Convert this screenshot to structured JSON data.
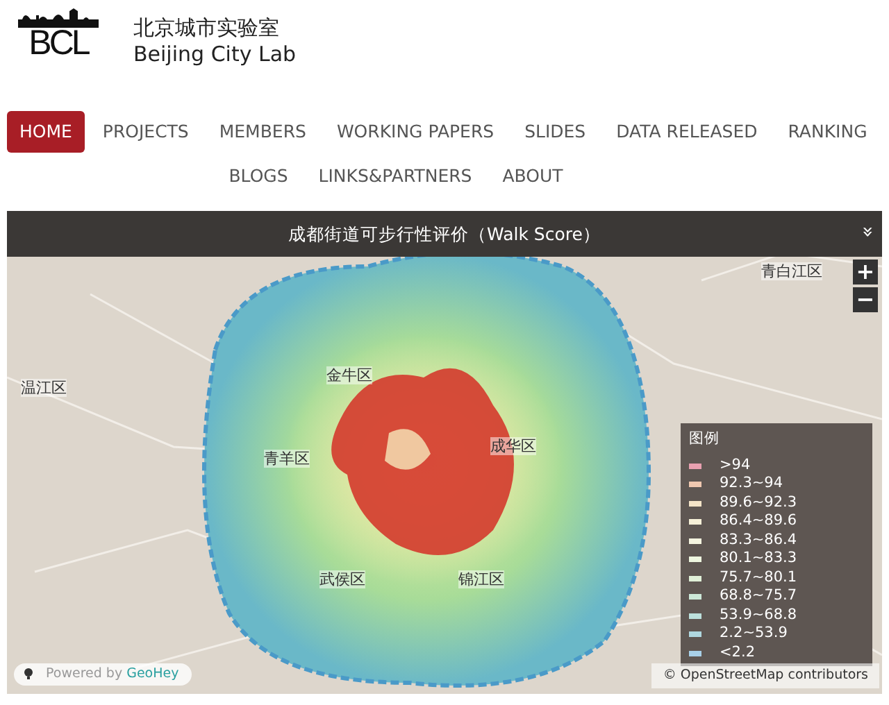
{
  "header": {
    "logo_text": "BCL",
    "title_cn": "北京城市实验室",
    "title_en": "Beijing City Lab"
  },
  "nav": [
    {
      "label": "HOME",
      "selected": true
    },
    {
      "label": "PROJECTS",
      "selected": false
    },
    {
      "label": "MEMBERS",
      "selected": false
    },
    {
      "label": "WORKING PAPERS",
      "selected": false
    },
    {
      "label": "SLIDES",
      "selected": false
    },
    {
      "label": "DATA RELEASED",
      "selected": false
    },
    {
      "label": "RANKING",
      "selected": false
    },
    {
      "label": "BLOGS",
      "selected": false
    },
    {
      "label": "LINKS&PARTNERS",
      "selected": false
    },
    {
      "label": "ABOUT",
      "selected": false
    }
  ],
  "map": {
    "title": "成都街道可步行性评价（Walk Score）",
    "collapse_icon": "»",
    "zoom_in": "+",
    "zoom_out": "−",
    "labels": [
      {
        "text": "青白江区",
        "kind": "district"
      },
      {
        "text": "温江区",
        "kind": "district"
      },
      {
        "text": "金牛区",
        "kind": "district"
      },
      {
        "text": "青羊区",
        "kind": "district"
      },
      {
        "text": "成华区",
        "kind": "district"
      },
      {
        "text": "武侯区",
        "kind": "district"
      },
      {
        "text": "锦江区",
        "kind": "district"
      }
    ],
    "legend": {
      "title": "图例",
      "items": [
        {
          "label": ">94",
          "color": "#e8a0b0"
        },
        {
          "label": "92.3~94",
          "color": "#f0c8b0"
        },
        {
          "label": "89.6~92.3",
          "color": "#f4e4c8"
        },
        {
          "label": "86.4~89.6",
          "color": "#f6f0d8"
        },
        {
          "label": "83.3~86.4",
          "color": "#f4f4e0"
        },
        {
          "label": "80.1~83.3",
          "color": "#eef6e0"
        },
        {
          "label": "75.7~80.1",
          "color": "#e0f0d8"
        },
        {
          "label": "68.8~75.7",
          "color": "#cce8d8"
        },
        {
          "label": "53.9~68.8",
          "color": "#bce0dc"
        },
        {
          "label": "2.2~53.9",
          "color": "#b0d8e0"
        },
        {
          "label": "<2.2",
          "color": "#a8d0e8"
        }
      ]
    },
    "powered_by": {
      "prefix": "Powered by",
      "brand": "GeoHey"
    },
    "attribution": {
      "symbol": "©",
      "link": "OpenStreetMap",
      "suffix": "contributors"
    }
  }
}
